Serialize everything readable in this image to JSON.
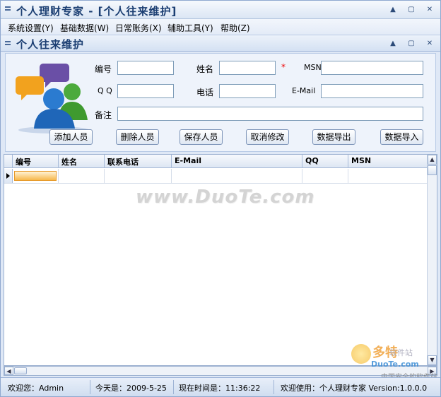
{
  "window": {
    "title": "个人理财专家 - [个人往来维护]"
  },
  "menu": [
    {
      "label": "系统设置(Y)"
    },
    {
      "label": "基础数据(W)"
    },
    {
      "label": "日常账务(X)"
    },
    {
      "label": "辅助工具(Y)"
    },
    {
      "label": "帮助(Z)"
    }
  ],
  "subwindow": {
    "title": "个人往来维护"
  },
  "form": {
    "labels": {
      "id": "编号",
      "name": "姓名",
      "msn": "MSN",
      "qq": "Q Q",
      "phone": "电话",
      "email": "E-Mail",
      "note": "备注",
      "required_mark": "*"
    },
    "values": {
      "id": "",
      "name": "",
      "msn": "",
      "qq": "",
      "phone": "",
      "email": "",
      "note": ""
    }
  },
  "buttons": {
    "add": "添加人员",
    "delete": "删除人员",
    "save": "保存人员",
    "cancel": "取消修改",
    "export": "数据导出",
    "import": "数据导入"
  },
  "grid": {
    "columns": [
      "编号",
      "姓名",
      "联系电话",
      "E-Mail",
      "QQ",
      "MSN"
    ],
    "rows": [
      [
        "",
        "",
        "",
        "",
        "",
        ""
      ]
    ]
  },
  "watermark": "www.DuoTe.com",
  "logo": {
    "brand": "多特",
    "sub": "软件站",
    "url": "DuoTe.com",
    "slogan": "中国安全的软件站"
  },
  "status": {
    "welcome": "欢迎您：Admin",
    "today": "今天是：2009-5-25",
    "time": "现在时间是：11:36:22",
    "version": "欢迎使用：个人理财专家 Version:1.0.0.0"
  },
  "icons": {
    "minimize": "minimize-icon",
    "restore": "restore-icon",
    "close": "close-icon"
  }
}
